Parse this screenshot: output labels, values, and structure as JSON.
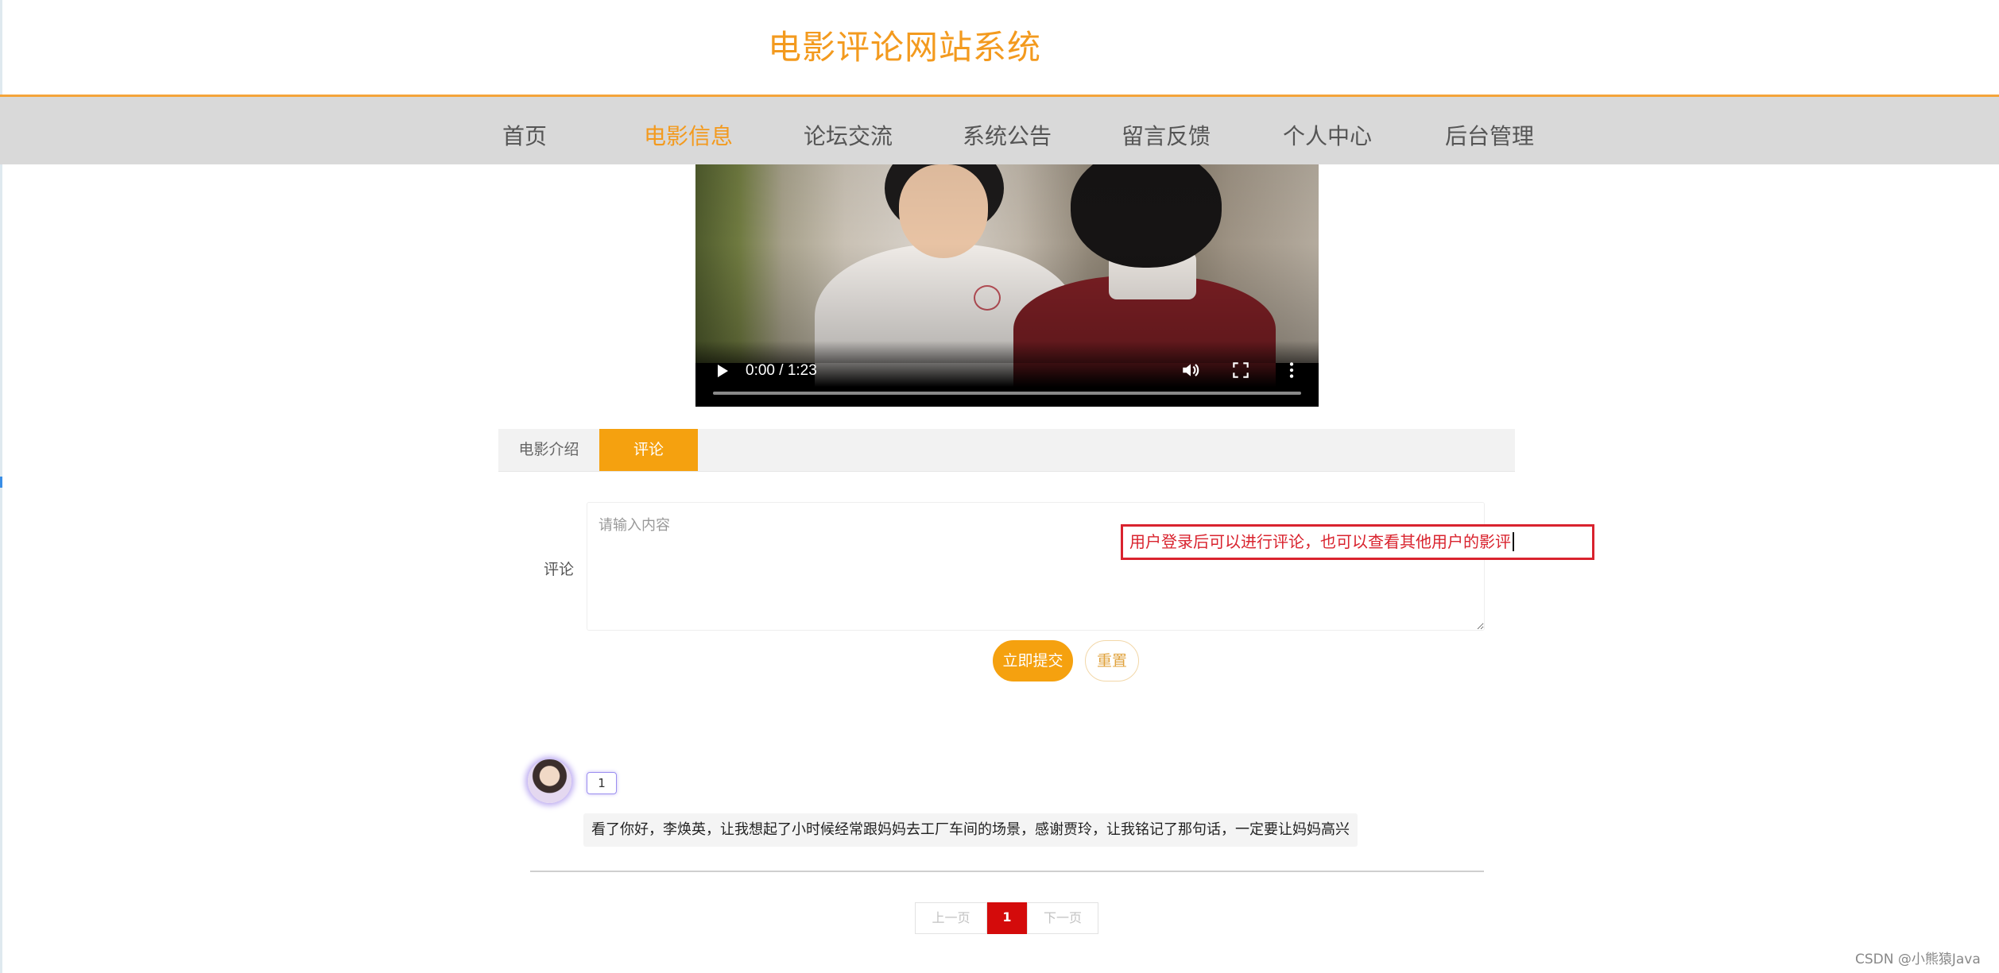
{
  "site": {
    "title": "电影评论网站系统"
  },
  "nav": {
    "items": [
      {
        "label": "首页"
      },
      {
        "label": "电影信息",
        "active": true
      },
      {
        "label": "论坛交流"
      },
      {
        "label": "系统公告"
      },
      {
        "label": "留言反馈"
      },
      {
        "label": "个人中心"
      },
      {
        "label": "后台管理"
      }
    ]
  },
  "video": {
    "time": "0:00 / 1:23",
    "progress": 0,
    "icons": [
      "play-icon",
      "volume-icon",
      "fullscreen-icon",
      "more-options-icon"
    ]
  },
  "tabs": {
    "intro": "电影介绍",
    "comment": "评论",
    "active": "评论"
  },
  "form": {
    "label": "评论",
    "placeholder": "请输入内容",
    "submit": "立即提交",
    "reset": "重置"
  },
  "annotation": {
    "text": "用户登录后可以进行评论，也可以查看其他用户的影评"
  },
  "comments": [
    {
      "user": "1",
      "text": "看了你好，李焕英，让我想起了小时候经常跟妈妈去工厂车间的场景，感谢贾玲，让我铭记了那句话，一定要让妈妈高兴"
    }
  ],
  "pagination": {
    "prev": "上一页",
    "current": "1",
    "next": "下一页"
  },
  "watermark": "CSDN @小熊猿Java",
  "colors": {
    "accent": "#f5a10f",
    "title": "#f39a1e",
    "nav_bg": "#d9d9d9",
    "page_active": "#d40b0b",
    "annotation": "#d9232e"
  }
}
